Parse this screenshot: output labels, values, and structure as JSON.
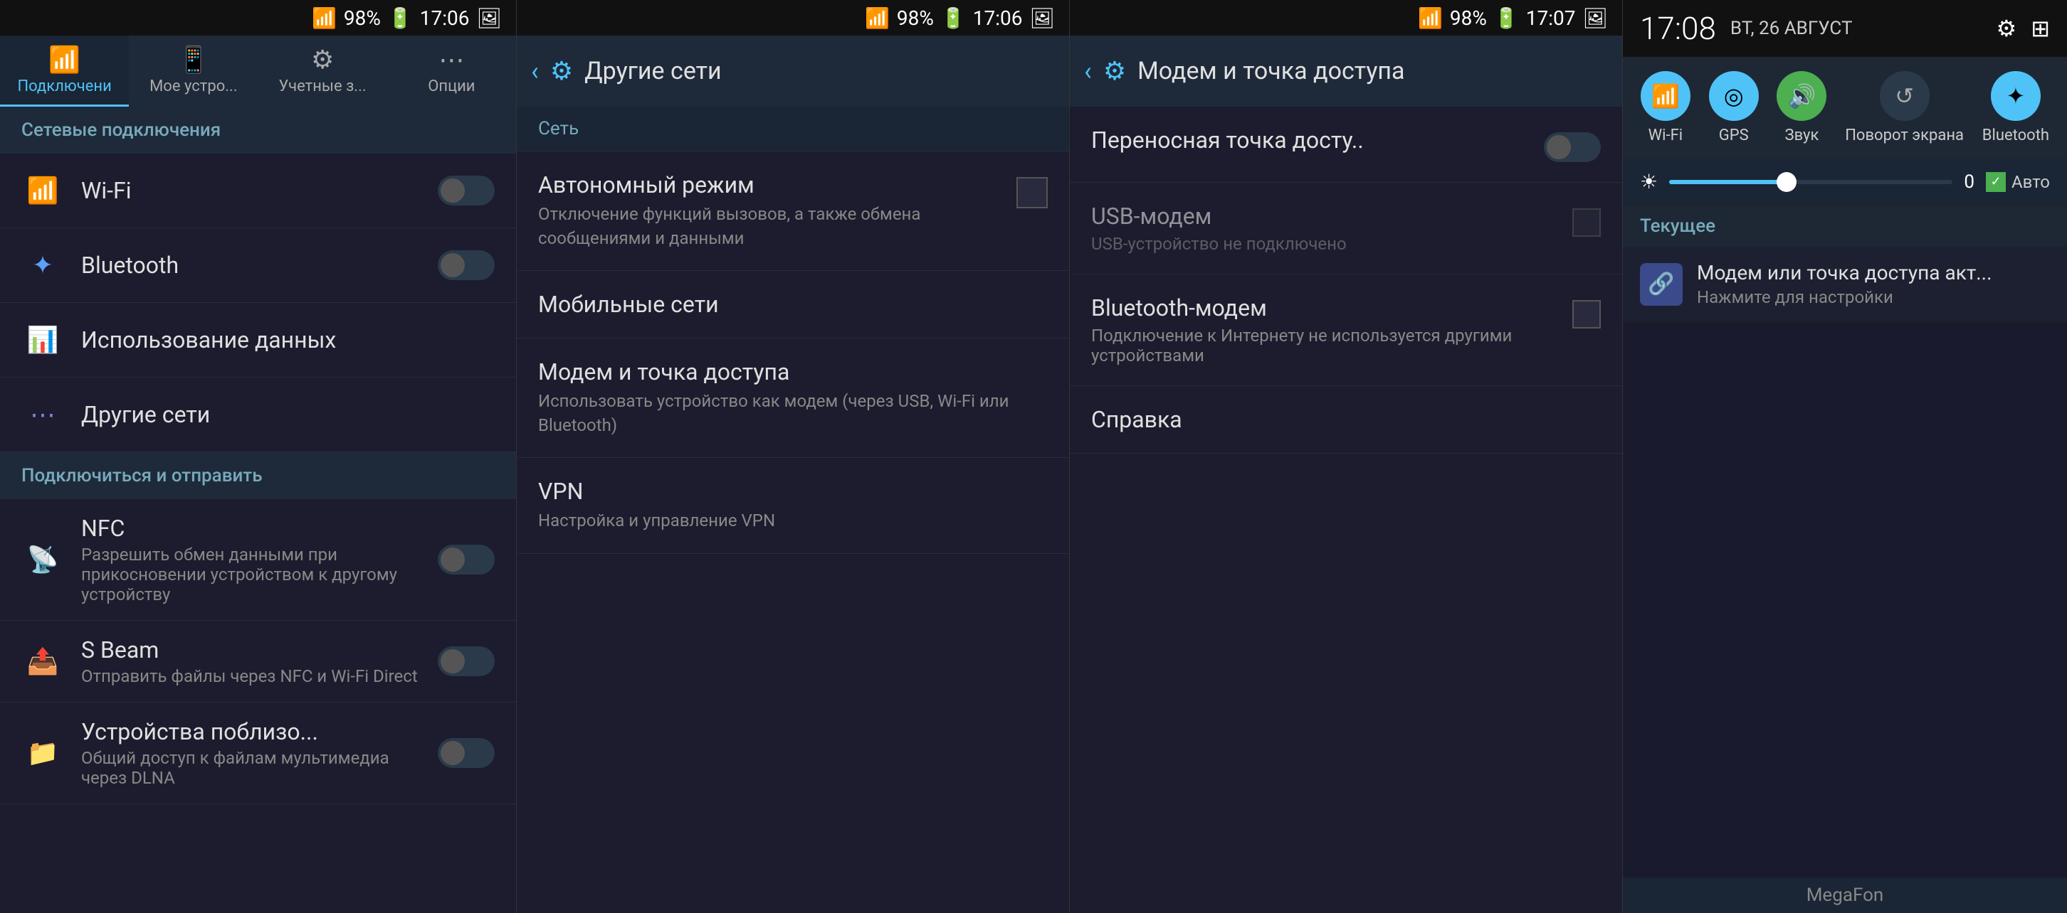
{
  "panel1": {
    "statusBar": {
      "signal": "98%",
      "time": "17:06",
      "imageIcon": "🖼"
    },
    "tabs": [
      {
        "id": "connections",
        "icon": "📶",
        "label": "Подключени",
        "active": true
      },
      {
        "id": "mydevice",
        "icon": "📱",
        "label": "Мое устро..."
      },
      {
        "id": "accounts",
        "icon": "⚙",
        "label": "Учетные з..."
      },
      {
        "id": "options",
        "icon": "⋯",
        "label": "Опции"
      }
    ],
    "sectionHeader": "Сетевые подключения",
    "items": [
      {
        "icon": "wifi",
        "iconChar": "📶",
        "title": "Wi-Fi",
        "toggle": true
      },
      {
        "icon": "bluetooth",
        "iconChar": "✦",
        "title": "Bluetooth",
        "toggle": true
      },
      {
        "icon": "data",
        "iconChar": "📊",
        "title": "Использование данных"
      },
      {
        "icon": "other",
        "iconChar": "⋯",
        "title": "Другие сети"
      }
    ],
    "section2Header": "Подключиться и отправить",
    "items2": [
      {
        "icon": "nfc",
        "iconChar": "📡",
        "title": "NFC",
        "subtitle": "Разрешить обмен данными при прикосновении устройством к другому устройству",
        "toggle": true
      },
      {
        "icon": "sbeam",
        "iconChar": "📤",
        "title": "S Beam",
        "subtitle": "Отправить файлы через NFC и Wi-Fi Direct",
        "toggle": true
      },
      {
        "icon": "nearby",
        "iconChar": "📁",
        "title": "Устройства поблизо...",
        "subtitle": "Общий доступ к файлам мультимедиа через DLNA",
        "toggle": true
      }
    ]
  },
  "panel2": {
    "statusBar": {
      "signal": "98%",
      "time": "17:06",
      "imageIcon": "🖼"
    },
    "header": {
      "title": "Другие сети"
    },
    "sectionHeader": "Сеть",
    "items": [
      {
        "title": "Автономный режим",
        "subtitle": "Отключение функций вызовов, а также обмена сообщениями и данными",
        "hasCheckbox": true
      },
      {
        "title": "Мобильные сети",
        "subtitle": ""
      },
      {
        "title": "Модем и точка доступа",
        "subtitle": "Использовать устройство как модем (через USB, Wi-Fi или Bluetooth)"
      },
      {
        "title": "VPN",
        "subtitle": "Настройка и управление VPN"
      }
    ]
  },
  "panel3": {
    "statusBar": {
      "signal": "98%",
      "time": "17:07",
      "imageIcon": "🖼"
    },
    "header": {
      "title": "Модем и точка доступа"
    },
    "items": [
      {
        "title": "Переносная точка досту..",
        "subtitle": "",
        "hasToggle": true,
        "toggleOn": false
      },
      {
        "title": "USB-модем",
        "subtitle": "USB-устройство не подключено",
        "hasCheckbox": true,
        "disabled": true
      },
      {
        "title": "Bluetooth-модем",
        "subtitle": "Подключение к Интернету не используется другими устройствами",
        "hasCheckbox": true
      },
      {
        "title": "Справка",
        "subtitle": ""
      }
    ]
  },
  "panel4": {
    "time": "17:08",
    "date": "ВТ, 26 АВГУСТ",
    "quickToggles": [
      {
        "id": "wifi",
        "icon": "📶",
        "label": "Wi-Fi",
        "active": true
      },
      {
        "id": "gps",
        "icon": "◎",
        "label": "GPS",
        "active": true
      },
      {
        "id": "sound",
        "icon": "🔊",
        "label": "Звук",
        "active": true
      },
      {
        "id": "rotate",
        "icon": "↺",
        "label": "Поворот экрана",
        "active": false
      },
      {
        "id": "bluetooth",
        "icon": "✦",
        "label": "Bluetooth",
        "active": true
      }
    ],
    "brightness": {
      "value": "0",
      "autoLabel": "Авто"
    },
    "sectionHeader": "Текущее",
    "notifications": [
      {
        "icon": "🔗",
        "title": "Модем или точка доступа акт...",
        "subtitle": "Нажмите для настройки"
      }
    ],
    "operator": "MegaFon"
  }
}
